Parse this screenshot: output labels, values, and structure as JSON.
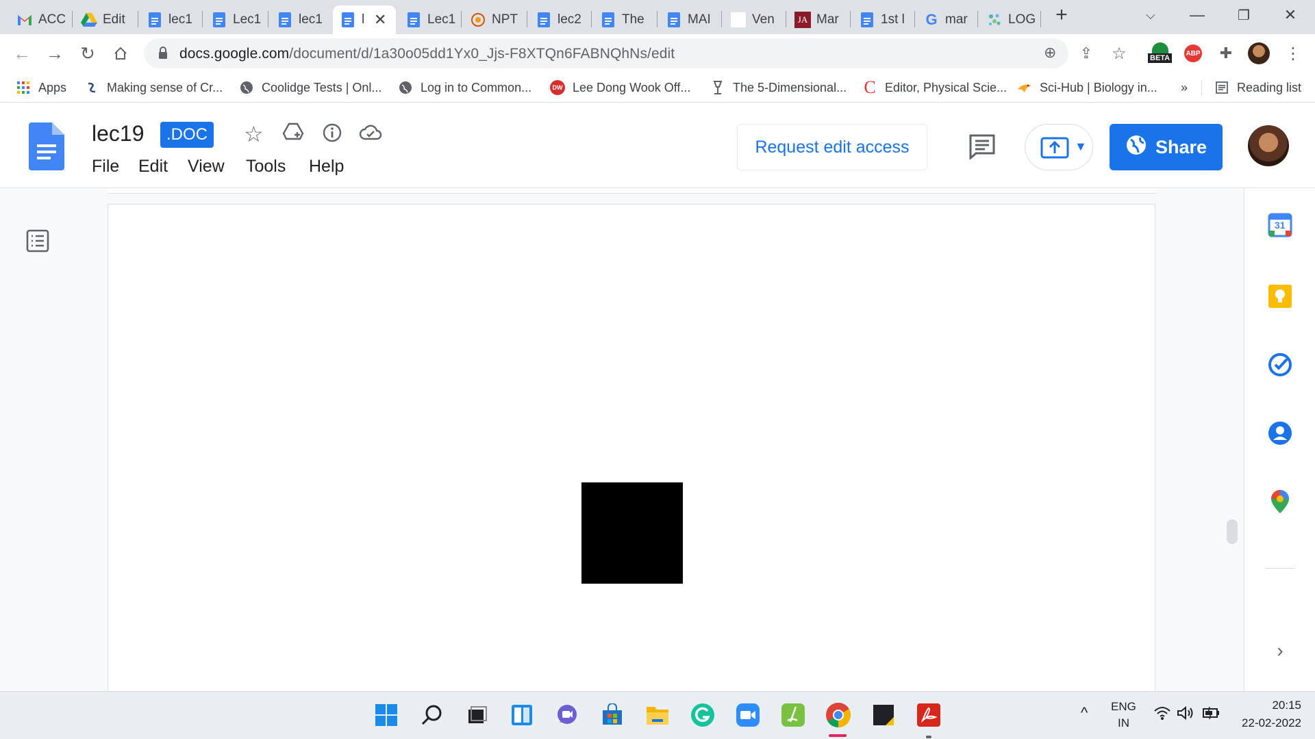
{
  "browser": {
    "tabs": [
      {
        "title": "ACC",
        "icon": "gmail-icon"
      },
      {
        "title": "Edit",
        "icon": "drive-icon"
      },
      {
        "title": "lec1",
        "icon": "docs-icon"
      },
      {
        "title": "Lec1",
        "icon": "docs-icon"
      },
      {
        "title": "lec1",
        "icon": "docs-icon"
      },
      {
        "title": "l",
        "icon": "docs-icon",
        "active": true
      },
      {
        "title": "Lec1",
        "icon": "docs-icon"
      },
      {
        "title": "NPT",
        "icon": "nptel-icon"
      },
      {
        "title": "lec2",
        "icon": "docs-icon"
      },
      {
        "title": "The",
        "icon": "docs-icon"
      },
      {
        "title": "MAI",
        "icon": "docs-icon"
      },
      {
        "title": "Ven",
        "icon": "blank-icon"
      },
      {
        "title": "Mar",
        "icon": "ja-icon"
      },
      {
        "title": "1st l",
        "icon": "docs-icon"
      },
      {
        "title": "mar",
        "icon": "google-icon"
      },
      {
        "title": "LOG",
        "icon": "logo-icon"
      }
    ],
    "url_host": "docs.google.com",
    "url_path": "/document/d/1a30o05dd1Yx0_Jjs-F8XTQn6FABNQhNs/edit",
    "beta_label": "BETA",
    "abp_label": "ABP",
    "bookmarks": [
      {
        "label": "Apps"
      },
      {
        "label": "Making sense of Cr..."
      },
      {
        "label": "Coolidge Tests | Onl..."
      },
      {
        "label": "Log in to Common..."
      },
      {
        "label": "Lee Dong Wook Off..."
      },
      {
        "label": "The 5-Dimensional..."
      },
      {
        "label": "Editor, Physical Scie..."
      },
      {
        "label": "Sci-Hub | Biology in..."
      }
    ],
    "more_bookmarks": "»",
    "reading_list": "Reading list"
  },
  "docs": {
    "title": "lec19",
    "badge": ".DOC",
    "menu": [
      "File",
      "Edit",
      "View",
      "Tools",
      "Help"
    ],
    "request_edit": "Request edit access",
    "share": "Share"
  },
  "side_panel": {
    "calendar_day": "31"
  },
  "taskbar": {
    "lang_top": "ENG",
    "lang_bottom": "IN",
    "time": "20:15",
    "date": "22-02-2022"
  }
}
